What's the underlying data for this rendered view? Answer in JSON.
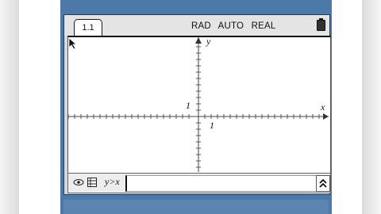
{
  "tab": {
    "label": "1.1"
  },
  "status": {
    "angle_mode": "RAD",
    "calc_mode": "AUTO",
    "number_mode": "REAL"
  },
  "graph": {
    "x_axis_label": "x",
    "y_axis_label": "y",
    "x_tick_label": "1",
    "y_tick_label": "1"
  },
  "entry": {
    "relation": "y>x",
    "value": ""
  },
  "icons": {
    "view": "eye-icon",
    "table": "table-icon",
    "expand": "double-chevron-up-icon",
    "battery": "battery-icon",
    "pointer": "mouse-pointer-icon"
  },
  "colors": {
    "bezel": "#4d79a8",
    "screen": "#ffffff",
    "panel": "#d9d9d9"
  }
}
